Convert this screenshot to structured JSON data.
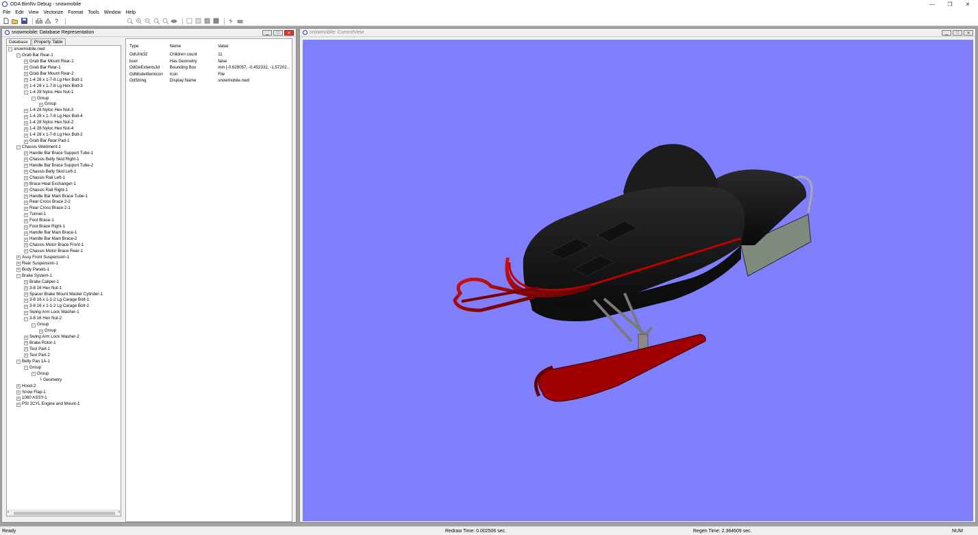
{
  "app": {
    "title": "ODA BimNv Debug - snowmobile",
    "window_controls": [
      "—",
      "❐",
      "✕"
    ]
  },
  "menu": [
    "File",
    "Edit",
    "View",
    "Vectorize",
    "Format",
    "Tools",
    "Window",
    "Help"
  ],
  "db_window": {
    "title": "snowmobile: Database Representation",
    "tabs": [
      "Database",
      "Property Table"
    ],
    "tree": [
      {
        "depth": 0,
        "exp": "−",
        "label": "snowmobile.nwd"
      },
      {
        "depth": 1,
        "exp": "−",
        "label": "Grab Bar Rear-1"
      },
      {
        "depth": 2,
        "exp": "+",
        "label": "Grab Bar Mount Rear-1"
      },
      {
        "depth": 2,
        "exp": "+",
        "label": "Grab Bar Rear-1"
      },
      {
        "depth": 2,
        "exp": "+",
        "label": "Grab Bar Mount Rear-2"
      },
      {
        "depth": 2,
        "exp": "+",
        "label": "1-4 28 x 1-7-8 Lg Hex Bolt-1"
      },
      {
        "depth": 2,
        "exp": "+",
        "label": "1-4 28 x 1-7-8 Lg Hex Bolt-3"
      },
      {
        "depth": 2,
        "exp": "−",
        "label": "1-4 28 Nyloc Hex Nut-1"
      },
      {
        "depth": 3,
        "exp": "−",
        "label": "Group"
      },
      {
        "depth": 4,
        "exp": "+",
        "label": "Group"
      },
      {
        "depth": 2,
        "exp": "+",
        "label": "1-4 28 Nyloc Hex Nut-3"
      },
      {
        "depth": 2,
        "exp": "+",
        "label": "1-4 28 x 1-7-8 Lg Hex Bolt-4"
      },
      {
        "depth": 2,
        "exp": "+",
        "label": "1-4 28 Nyloc Hex Nut-2"
      },
      {
        "depth": 2,
        "exp": "+",
        "label": "1-4 28 Nyloc Hex Nut-4"
      },
      {
        "depth": 2,
        "exp": "+",
        "label": "1-4 28 x 1-7-8 Lg Hex Bolt-2"
      },
      {
        "depth": 2,
        "exp": "+",
        "label": "Grab Bar Rear Pad-1"
      },
      {
        "depth": 1,
        "exp": "−",
        "label": "Chassis Weldment-1"
      },
      {
        "depth": 2,
        "exp": "+",
        "label": "Handle Bar Brace Support Tube-1"
      },
      {
        "depth": 2,
        "exp": "+",
        "label": "Chassis Belly Skid Right-1"
      },
      {
        "depth": 2,
        "exp": "+",
        "label": "Handle Bar Brace Support Tube-2"
      },
      {
        "depth": 2,
        "exp": "+",
        "label": "Chassis Belly Skid Left-1"
      },
      {
        "depth": 2,
        "exp": "+",
        "label": "Chassis Rail Left-1"
      },
      {
        "depth": 2,
        "exp": "+",
        "label": "Brace Heat Exchanger-1"
      },
      {
        "depth": 2,
        "exp": "+",
        "label": "Chassis Rail Right-1"
      },
      {
        "depth": 2,
        "exp": "+",
        "label": "Handle Bar Main Brace Tube-1"
      },
      {
        "depth": 2,
        "exp": "+",
        "label": "Rear Cross Brace 2-2"
      },
      {
        "depth": 2,
        "exp": "+",
        "label": "Rear Cross Brace 2-1"
      },
      {
        "depth": 2,
        "exp": "+",
        "label": "Tunnel-1"
      },
      {
        "depth": 2,
        "exp": "+",
        "label": "Foot Brace-1"
      },
      {
        "depth": 2,
        "exp": "+",
        "label": "Foot Brace Right-1"
      },
      {
        "depth": 2,
        "exp": "+",
        "label": "Handle Bar Main Brace-1"
      },
      {
        "depth": 2,
        "exp": "+",
        "label": "Handle Bar Main Brace-2"
      },
      {
        "depth": 2,
        "exp": "+",
        "label": "Chassis Motor Brace Front-1"
      },
      {
        "depth": 2,
        "exp": "+",
        "label": "Chassis Motor Brace Rear-1"
      },
      {
        "depth": 1,
        "exp": "+",
        "label": "Assy Front Suspension-1"
      },
      {
        "depth": 1,
        "exp": "+",
        "label": "Rear Suspension-1"
      },
      {
        "depth": 1,
        "exp": "+",
        "label": "Body Panels-1"
      },
      {
        "depth": 1,
        "exp": "−",
        "label": "Brake System-1"
      },
      {
        "depth": 2,
        "exp": "+",
        "label": "Brake Caliper-1"
      },
      {
        "depth": 2,
        "exp": "+",
        "label": "3-8 16 Hex Nut-1"
      },
      {
        "depth": 2,
        "exp": "+",
        "label": "Spacer Brake Mount Master Cylinder-1"
      },
      {
        "depth": 2,
        "exp": "+",
        "label": "3-8 16 x 1-1-2 Lg Carage Bolt-1"
      },
      {
        "depth": 2,
        "exp": "+",
        "label": "3-8 16 x 1-1-2 Lg Carage Bolt-2"
      },
      {
        "depth": 2,
        "exp": "+",
        "label": "Swing Arm Lock Washer-1"
      },
      {
        "depth": 2,
        "exp": "−",
        "label": "3-8 16 Hex Nut-2"
      },
      {
        "depth": 3,
        "exp": "−",
        "label": "Group"
      },
      {
        "depth": 4,
        "exp": "+",
        "label": "Group"
      },
      {
        "depth": 2,
        "exp": "+",
        "label": "Swing Arm Lock Washer-2"
      },
      {
        "depth": 2,
        "exp": "+",
        "label": "Brake Rotor-1"
      },
      {
        "depth": 2,
        "exp": "+",
        "label": "Test Part-1"
      },
      {
        "depth": 2,
        "exp": "+",
        "label": "Test Part-2"
      },
      {
        "depth": 1,
        "exp": "−",
        "label": "Belly Pan 1A-1"
      },
      {
        "depth": 2,
        "exp": "−",
        "label": "Group"
      },
      {
        "depth": 3,
        "exp": "−",
        "label": "Group"
      },
      {
        "depth": 4,
        "exp": "",
        "label": "└ Geometry"
      },
      {
        "depth": 1,
        "exp": "+",
        "label": "Hood-2"
      },
      {
        "depth": 1,
        "exp": "+",
        "label": "Snow Flap-1"
      },
      {
        "depth": 1,
        "exp": "+",
        "label": "1060 ASSY-1"
      },
      {
        "depth": 1,
        "exp": "+",
        "label": "PSI 2CYL Engine and Mount-1"
      }
    ],
    "properties": {
      "headers": [
        "Type",
        "Name",
        "Value"
      ],
      "rows": [
        [
          "OdUInt32",
          "Children count",
          "11"
        ],
        [
          "bool",
          "Has Geometry",
          "false"
        ],
        [
          "OdGeExtents3d",
          "Bounding Box",
          "min [-0.628057, -0.452332, -1.57202..."
        ],
        [
          "OdModelItemIcon",
          "Icon",
          "File"
        ],
        [
          "OdString",
          "Display Name",
          "snowmobile.nwd"
        ]
      ]
    }
  },
  "view_window": {
    "title": "snowmobile: CurrentView",
    "background": "#8080ff"
  },
  "status": {
    "ready": "Ready",
    "redraw": "Redraw Time: 0.002506 sec.",
    "regen": "Regen Time: 2.384609 sec.",
    "num": "NUM"
  },
  "toolbar_icons": [
    "new-icon",
    "open-icon",
    "save-icon",
    "print-icon",
    "print-preview-icon",
    "help-icon",
    "zoom-extents-icon",
    "zoom-in-icon",
    "zoom-out-icon",
    "zoom-window-icon",
    "zoom-dynamic-icon",
    "orbit-icon",
    "render-wireframe-icon",
    "render-hidden-icon",
    "render-shaded-icon",
    "render-gouraud-icon",
    "lightning-icon",
    "camera-icon"
  ]
}
